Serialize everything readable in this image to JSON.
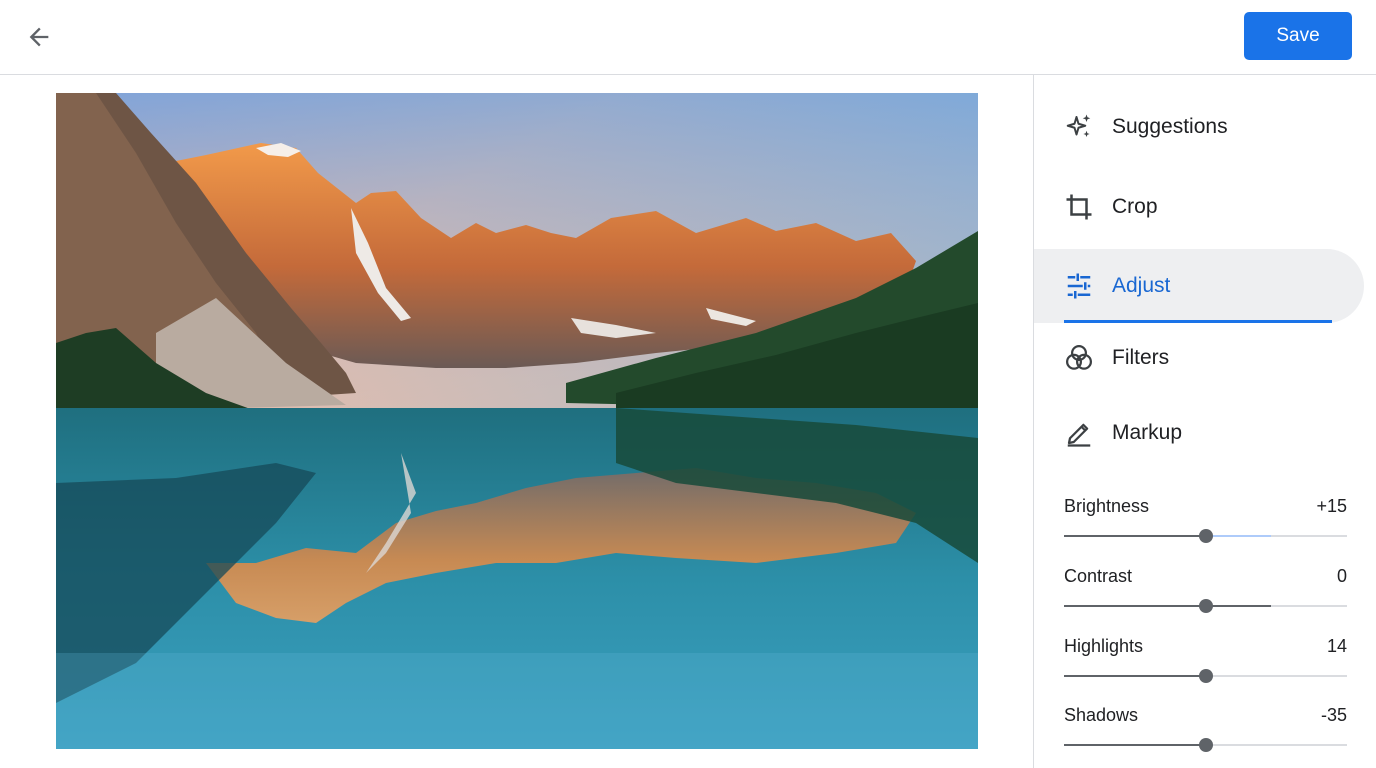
{
  "toolbar": {
    "back_icon": "arrow-left-icon",
    "save_label": "Save",
    "accent": "#1a73e8"
  },
  "photo": {
    "subject": "mountain-lake-photo"
  },
  "tools": [
    {
      "label": "Suggestions",
      "icon": "sparkle-icon",
      "active": false
    },
    {
      "label": "Crop",
      "icon": "crop-icon",
      "active": false
    },
    {
      "label": "Adjust",
      "icon": "tune-icon",
      "active": true
    },
    {
      "label": "Filters",
      "icon": "filters-icon",
      "active": false
    },
    {
      "label": "Markup",
      "icon": "pen-icon",
      "active": false
    }
  ],
  "adjustments": [
    {
      "label": "Brightness",
      "value": "+15",
      "level": 0.5,
      "extra": 0.23
    },
    {
      "label": "Contrast",
      "value": "0",
      "level": 0.5,
      "extra": 0.23
    },
    {
      "label": "Highlights",
      "value": "14",
      "level": 0.5,
      "extra": 0
    },
    {
      "label": "Shadows",
      "value": "-35",
      "level": 0.5,
      "extra": 0
    }
  ]
}
